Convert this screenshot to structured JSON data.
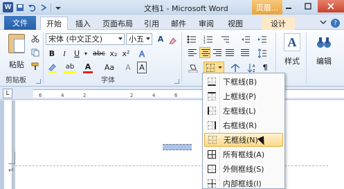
{
  "title_bar": {
    "title": "文档1 - Microsoft Word",
    "context_header": "页眉...",
    "logo": "W"
  },
  "tabs": [
    {
      "label": "文件"
    },
    {
      "label": "开始"
    },
    {
      "label": "插入"
    },
    {
      "label": "页面布局"
    },
    {
      "label": "引用"
    },
    {
      "label": "邮件"
    },
    {
      "label": "审阅"
    },
    {
      "label": "视图"
    },
    {
      "label": "设计"
    }
  ],
  "ribbon": {
    "clipboard": {
      "paste_label": "粘贴",
      "group_label": "剪贴板"
    },
    "font": {
      "font_name": "宋体 (中文正文)",
      "font_size": "小五",
      "group_label": "字体",
      "bold": "B",
      "italic": "I",
      "underline": "U",
      "strike": "abc",
      "sub": "x₂",
      "sup": "x²",
      "case": "Aa",
      "highlight": "ab",
      "color": "A",
      "grow": "A",
      "char_border": "A",
      "char_shade": "A"
    },
    "styles": {
      "label": "样式"
    },
    "editing": {
      "label": "编辑"
    },
    "accent_color": "#ffe08f"
  },
  "ruler_numbers": [
    "6",
    "4",
    "2",
    "2",
    "4",
    "6"
  ],
  "border_menu": {
    "items": [
      {
        "label": "下框线(B)"
      },
      {
        "label": "上框线(P)"
      },
      {
        "label": "左框线(L)"
      },
      {
        "label": "右框线(R)"
      },
      {
        "label": "无框线(N)"
      },
      {
        "label": "所有框线(A)"
      },
      {
        "label": "外侧框线(S)"
      },
      {
        "label": "内部框线(I)"
      }
    ],
    "highlighted_item": "无框线(N)"
  },
  "paragraph_mark": "↵"
}
